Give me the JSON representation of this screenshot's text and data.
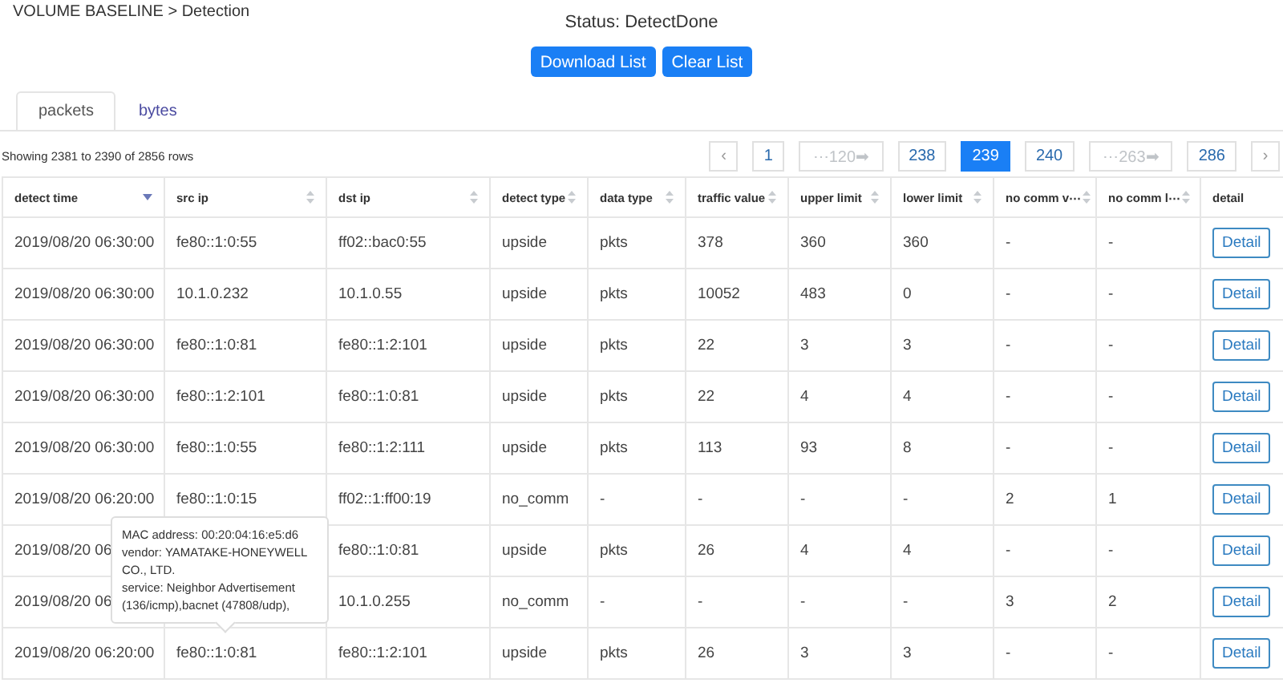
{
  "breadcrumb": "VOLUME BASELINE > Detection",
  "status": "Status: DetectDone",
  "buttons": [
    "Download List",
    "Clear List"
  ],
  "tabs": [
    {
      "label": "packets",
      "selected": true
    },
    {
      "label": "bytes",
      "selected": false
    }
  ],
  "summary": "Showing 2381 to 2390 of 2856 rows",
  "pagination": [
    {
      "kind": "prev",
      "label": "‹",
      "selected": false
    },
    {
      "kind": "page",
      "label": "1",
      "selected": false
    },
    {
      "kind": "jump",
      "label": "⋯120➡",
      "selected": false
    },
    {
      "kind": "page",
      "label": "238",
      "selected": false
    },
    {
      "kind": "page",
      "label": "239",
      "selected": true
    },
    {
      "kind": "page",
      "label": "240",
      "selected": false
    },
    {
      "kind": "jump",
      "label": "⋯263➡",
      "selected": false
    },
    {
      "kind": "page",
      "label": "286",
      "selected": false
    },
    {
      "kind": "next",
      "label": "›",
      "selected": false
    }
  ],
  "table": {
    "columns": [
      {
        "label": "detect time",
        "sortable": true,
        "sorted": true
      },
      {
        "label": "src ip",
        "sortable": true,
        "sorted": false
      },
      {
        "label": "dst ip",
        "sortable": true,
        "sorted": false
      },
      {
        "label": "detect type",
        "sortable": true,
        "sorted": false
      },
      {
        "label": "data type",
        "sortable": true,
        "sorted": false
      },
      {
        "label": "traffic value",
        "sortable": true,
        "sorted": false
      },
      {
        "label": "upper limit",
        "sortable": true,
        "sorted": false
      },
      {
        "label": "lower limit",
        "sortable": true,
        "sorted": false
      },
      {
        "label": "no comm v⋯",
        "sortable": true,
        "sorted": false
      },
      {
        "label": "no comm l⋯",
        "sortable": true,
        "sorted": false
      },
      {
        "label": "detail",
        "sortable": false,
        "sorted": false
      }
    ],
    "rows": [
      {
        "cells": [
          "2019/08/20 06:30:00",
          "fe80::1:0:55",
          "ff02::bac0:55",
          "upside",
          "pkts",
          "378",
          "360",
          "360",
          "-",
          "-"
        ],
        "action": "Detail"
      },
      {
        "cells": [
          "2019/08/20 06:30:00",
          "10.1.0.232",
          "10.1.0.55",
          "upside",
          "pkts",
          "10052",
          "483",
          "0",
          "-",
          "-"
        ],
        "action": "Detail"
      },
      {
        "cells": [
          "2019/08/20 06:30:00",
          "fe80::1:0:81",
          "fe80::1:2:101",
          "upside",
          "pkts",
          "22",
          "3",
          "3",
          "-",
          "-"
        ],
        "action": "Detail"
      },
      {
        "cells": [
          "2019/08/20 06:30:00",
          "fe80::1:2:101",
          "fe80::1:0:81",
          "upside",
          "pkts",
          "22",
          "4",
          "4",
          "-",
          "-"
        ],
        "action": "Detail"
      },
      {
        "cells": [
          "2019/08/20 06:30:00",
          "fe80::1:0:55",
          "fe80::1:2:111",
          "upside",
          "pkts",
          "113",
          "93",
          "8",
          "-",
          "-"
        ],
        "action": "Detail"
      },
      {
        "cells": [
          "2019/08/20 06:20:00",
          "fe80::1:0:15",
          "ff02::1:ff00:19",
          "no_comm",
          "-",
          "-",
          "-",
          "-",
          "2",
          "1"
        ],
        "action": "Detail"
      },
      {
        "cells": [
          "2019/08/20 06",
          null,
          "fe80::1:0:81",
          "upside",
          "pkts",
          "26",
          "4",
          "4",
          "-",
          "-"
        ],
        "action": "Detail"
      },
      {
        "cells": [
          "2019/08/20 06",
          null,
          "10.1.0.255",
          "no_comm",
          "-",
          "-",
          "-",
          "-",
          "3",
          "2"
        ],
        "action": "Detail"
      },
      {
        "cells": [
          "2019/08/20 06:20:00",
          "fe80::1:0:81",
          "fe80::1:2:101",
          "upside",
          "pkts",
          "26",
          "3",
          "3",
          "-",
          "-"
        ],
        "action": "Detail"
      }
    ]
  },
  "tooltip": {
    "lines": [
      "MAC address: 00:20:04:16:e5:d6",
      "vendor: YAMATAKE-HONEYWELL CO., LTD.",
      "service: Neighbor Advertisement (136/icmp),bacnet (47808/udp),"
    ]
  }
}
